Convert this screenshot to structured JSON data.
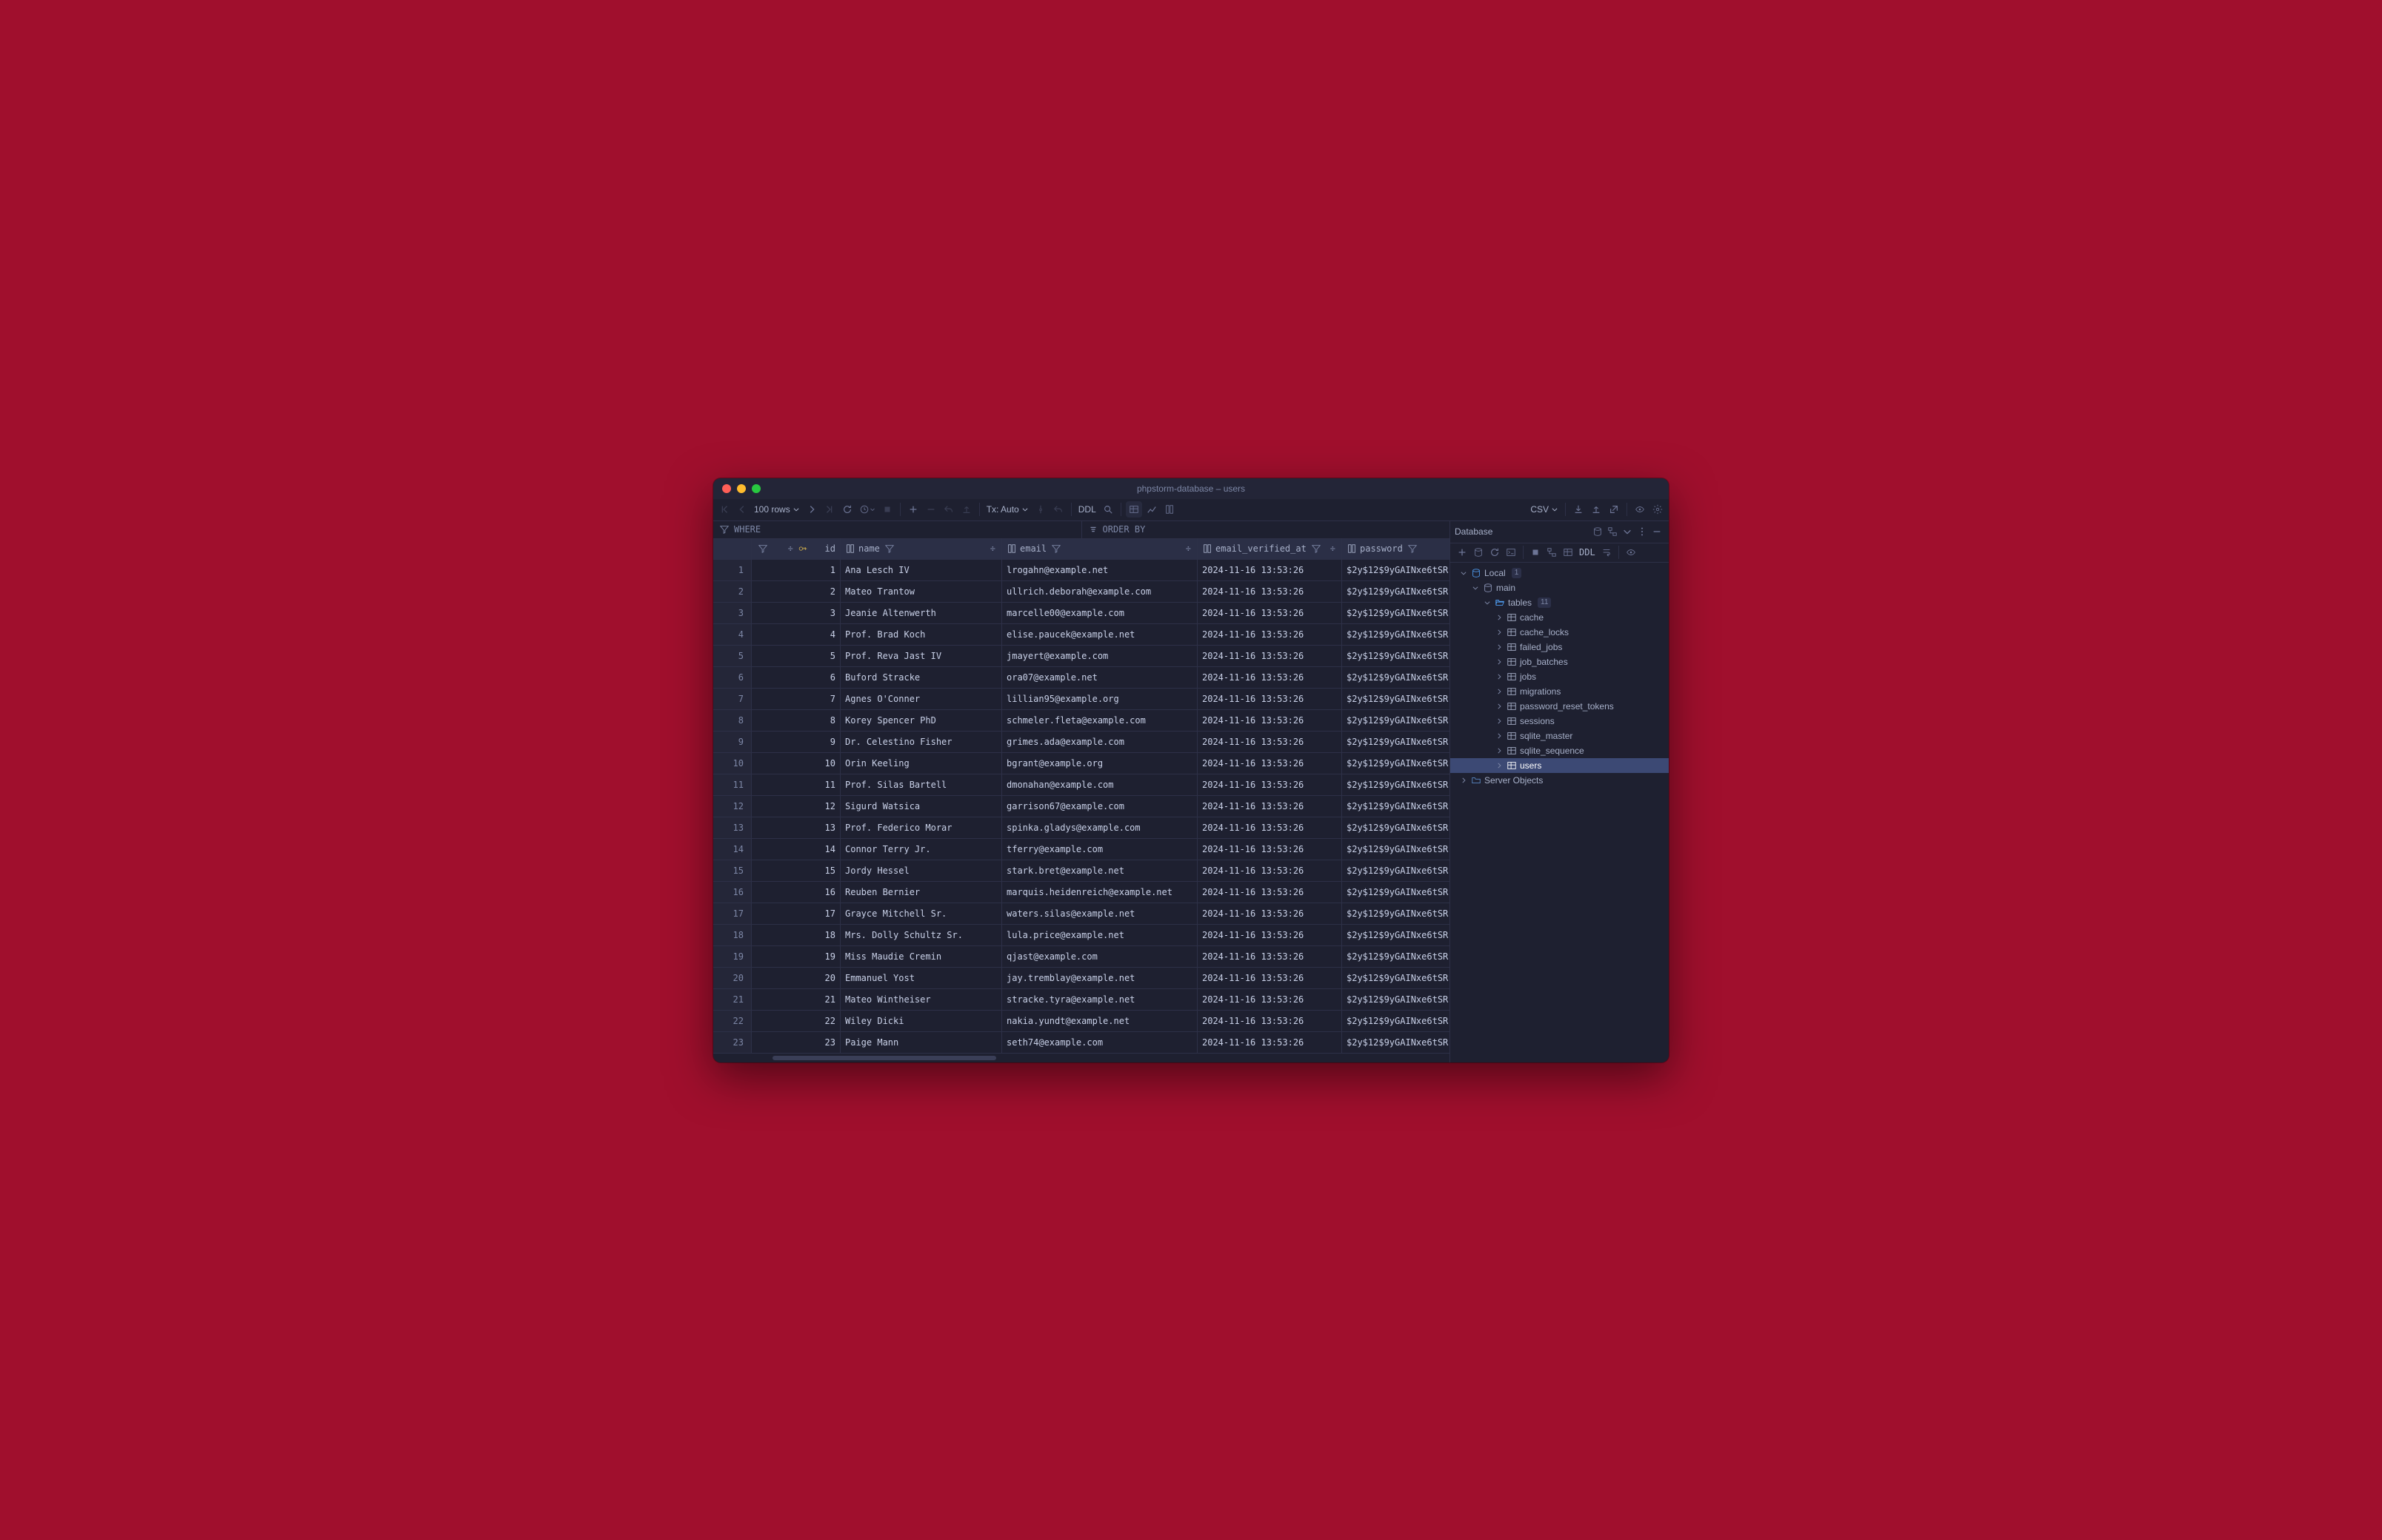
{
  "window_title": "phpstorm-database – users",
  "toolbar": {
    "rows_dropdown": "100 rows",
    "tx_mode": "Tx: Auto",
    "ddl_label": "DDL",
    "export_format": "CSV"
  },
  "filters": {
    "where_label": "WHERE",
    "orderby_label": "ORDER BY"
  },
  "columns": {
    "id": "id",
    "name": "name",
    "email": "email",
    "email_verified_at": "email_verified_at",
    "password": "password"
  },
  "rows": [
    {
      "n": 1,
      "id": 1,
      "name": "Ana Lesch IV",
      "email": "lrogahn@example.net",
      "verified": "2024-11-16 13:53:26",
      "password": "$2y$12$9yGAINxe6tSR"
    },
    {
      "n": 2,
      "id": 2,
      "name": "Mateo Trantow",
      "email": "ullrich.deborah@example.com",
      "verified": "2024-11-16 13:53:26",
      "password": "$2y$12$9yGAINxe6tSR"
    },
    {
      "n": 3,
      "id": 3,
      "name": "Jeanie Altenwerth",
      "email": "marcelle00@example.com",
      "verified": "2024-11-16 13:53:26",
      "password": "$2y$12$9yGAINxe6tSR"
    },
    {
      "n": 4,
      "id": 4,
      "name": "Prof. Brad Koch",
      "email": "elise.paucek@example.net",
      "verified": "2024-11-16 13:53:26",
      "password": "$2y$12$9yGAINxe6tSR"
    },
    {
      "n": 5,
      "id": 5,
      "name": "Prof. Reva Jast IV",
      "email": "jmayert@example.com",
      "verified": "2024-11-16 13:53:26",
      "password": "$2y$12$9yGAINxe6tSR"
    },
    {
      "n": 6,
      "id": 6,
      "name": "Buford Stracke",
      "email": "ora07@example.net",
      "verified": "2024-11-16 13:53:26",
      "password": "$2y$12$9yGAINxe6tSR"
    },
    {
      "n": 7,
      "id": 7,
      "name": "Agnes O'Conner",
      "email": "lillian95@example.org",
      "verified": "2024-11-16 13:53:26",
      "password": "$2y$12$9yGAINxe6tSR"
    },
    {
      "n": 8,
      "id": 8,
      "name": "Korey Spencer PhD",
      "email": "schmeler.fleta@example.com",
      "verified": "2024-11-16 13:53:26",
      "password": "$2y$12$9yGAINxe6tSR"
    },
    {
      "n": 9,
      "id": 9,
      "name": "Dr. Celestino Fisher",
      "email": "grimes.ada@example.com",
      "verified": "2024-11-16 13:53:26",
      "password": "$2y$12$9yGAINxe6tSR"
    },
    {
      "n": 10,
      "id": 10,
      "name": "Orin Keeling",
      "email": "bgrant@example.org",
      "verified": "2024-11-16 13:53:26",
      "password": "$2y$12$9yGAINxe6tSR"
    },
    {
      "n": 11,
      "id": 11,
      "name": "Prof. Silas Bartell",
      "email": "dmonahan@example.com",
      "verified": "2024-11-16 13:53:26",
      "password": "$2y$12$9yGAINxe6tSR"
    },
    {
      "n": 12,
      "id": 12,
      "name": "Sigurd Watsica",
      "email": "garrison67@example.com",
      "verified": "2024-11-16 13:53:26",
      "password": "$2y$12$9yGAINxe6tSR"
    },
    {
      "n": 13,
      "id": 13,
      "name": "Prof. Federico Morar",
      "email": "spinka.gladys@example.com",
      "verified": "2024-11-16 13:53:26",
      "password": "$2y$12$9yGAINxe6tSR"
    },
    {
      "n": 14,
      "id": 14,
      "name": "Connor Terry Jr.",
      "email": "tferry@example.com",
      "verified": "2024-11-16 13:53:26",
      "password": "$2y$12$9yGAINxe6tSR"
    },
    {
      "n": 15,
      "id": 15,
      "name": "Jordy Hessel",
      "email": "stark.bret@example.net",
      "verified": "2024-11-16 13:53:26",
      "password": "$2y$12$9yGAINxe6tSR"
    },
    {
      "n": 16,
      "id": 16,
      "name": "Reuben Bernier",
      "email": "marquis.heidenreich@example.net",
      "verified": "2024-11-16 13:53:26",
      "password": "$2y$12$9yGAINxe6tSR"
    },
    {
      "n": 17,
      "id": 17,
      "name": "Grayce Mitchell Sr.",
      "email": "waters.silas@example.net",
      "verified": "2024-11-16 13:53:26",
      "password": "$2y$12$9yGAINxe6tSR"
    },
    {
      "n": 18,
      "id": 18,
      "name": "Mrs. Dolly Schultz Sr.",
      "email": "lula.price@example.net",
      "verified": "2024-11-16 13:53:26",
      "password": "$2y$12$9yGAINxe6tSR"
    },
    {
      "n": 19,
      "id": 19,
      "name": "Miss Maudie Cremin",
      "email": "qjast@example.com",
      "verified": "2024-11-16 13:53:26",
      "password": "$2y$12$9yGAINxe6tSR"
    },
    {
      "n": 20,
      "id": 20,
      "name": "Emmanuel Yost",
      "email": "jay.tremblay@example.net",
      "verified": "2024-11-16 13:53:26",
      "password": "$2y$12$9yGAINxe6tSR"
    },
    {
      "n": 21,
      "id": 21,
      "name": "Mateo Wintheiser",
      "email": "stracke.tyra@example.net",
      "verified": "2024-11-16 13:53:26",
      "password": "$2y$12$9yGAINxe6tSR"
    },
    {
      "n": 22,
      "id": 22,
      "name": "Wiley Dicki",
      "email": "nakia.yundt@example.net",
      "verified": "2024-11-16 13:53:26",
      "password": "$2y$12$9yGAINxe6tSR"
    },
    {
      "n": 23,
      "id": 23,
      "name": "Paige Mann",
      "email": "seth74@example.com",
      "verified": "2024-11-16 13:53:26",
      "password": "$2y$12$9yGAINxe6tSR"
    }
  ],
  "side": {
    "panel_title": "Database",
    "ddl_label": "DDL",
    "tree": {
      "root": {
        "label": "Local",
        "badge": "1"
      },
      "db": {
        "label": "main"
      },
      "tables_group": {
        "label": "tables",
        "badge": "11"
      },
      "tables": [
        "cache",
        "cache_locks",
        "failed_jobs",
        "job_batches",
        "jobs",
        "migrations",
        "password_reset_tokens",
        "sessions",
        "sqlite_master",
        "sqlite_sequence",
        "users"
      ],
      "server_objects": "Server Objects"
    }
  }
}
